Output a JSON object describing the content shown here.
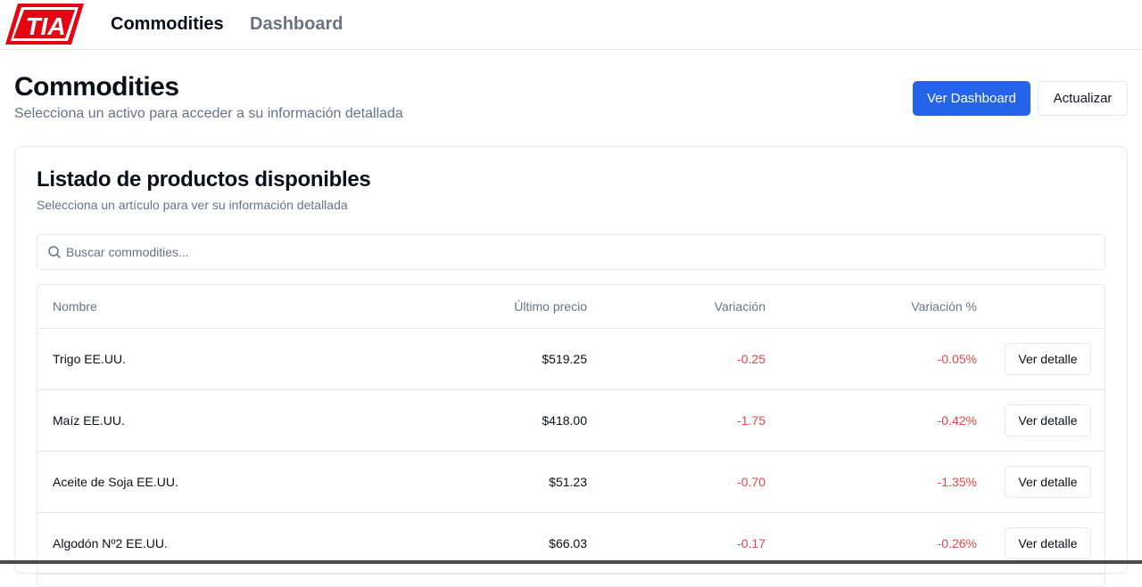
{
  "nav": {
    "logo_text": "TIA",
    "links": [
      "Commodities",
      "Dashboard"
    ]
  },
  "header": {
    "title": "Commodities",
    "subtitle": "Selecciona un activo para acceder a su información detallada",
    "primary_button": "Ver Dashboard",
    "secondary_button": "Actualizar"
  },
  "card": {
    "title": "Listado de productos disponibles",
    "subtitle": "Selecciona un artículo para ver su información detallada",
    "search_placeholder": "Buscar commodities...",
    "search_value": ""
  },
  "table": {
    "columns": [
      "Nombre",
      "Último precio",
      "Variación",
      "Variación %"
    ],
    "detail_label": "Ver detalle",
    "rows": [
      {
        "name": "Trigo EE.UU.",
        "price": "$519.25",
        "change": "-0.25",
        "change_pct": "-0.05%"
      },
      {
        "name": "Maíz EE.UU.",
        "price": "$418.00",
        "change": "-1.75",
        "change_pct": "-0.42%"
      },
      {
        "name": "Aceite de Soja EE.UU.",
        "price": "$51.23",
        "change": "-0.70",
        "change_pct": "-1.35%"
      },
      {
        "name": "Algodón Nº2 EE.UU.",
        "price": "$66.03",
        "change": "-0.17",
        "change_pct": "-0.26%"
      }
    ]
  },
  "colors": {
    "primary": "#2563eb",
    "negative": "#ef4444",
    "logo_red": "#e30613"
  },
  "icons": {
    "search": "search-icon",
    "logo": "tia-logo"
  }
}
